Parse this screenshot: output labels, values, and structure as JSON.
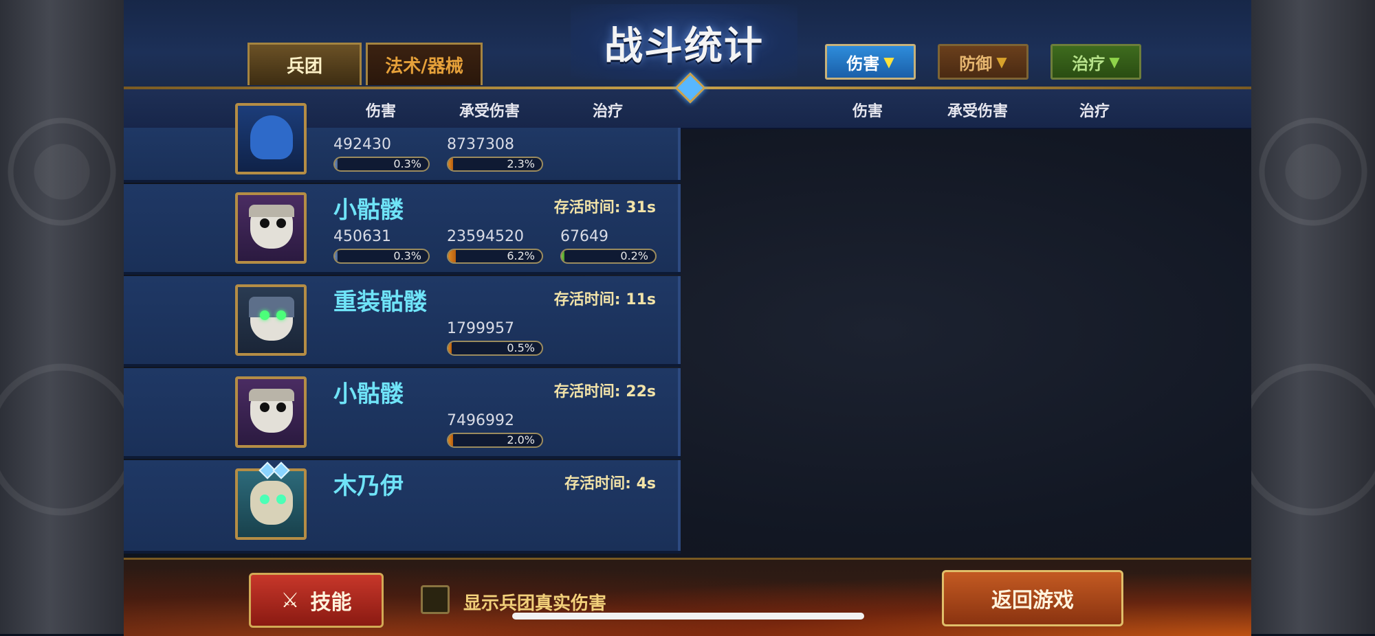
{
  "title": "战斗统计",
  "tabs": {
    "units": "兵团",
    "spells": "法术/器械"
  },
  "filters": {
    "damage": "伤害",
    "defense": "防御",
    "healing": "治疗"
  },
  "columns_left": [
    "伤害",
    "承受伤害",
    "治疗"
  ],
  "columns_right": [
    "伤害",
    "承受伤害",
    "治疗"
  ],
  "survive_prefix": "存活时间:",
  "rows": [
    {
      "name": "",
      "survive": "",
      "dmg": "492430",
      "dmg_pct": "0.3%",
      "taken": "8737308",
      "taken_pct": "2.3%",
      "heal": "",
      "heal_pct": "",
      "avatar_icon": "blue-dragon-icon"
    },
    {
      "name": "小骷髅",
      "survive": "31s",
      "dmg": "450631",
      "dmg_pct": "0.3%",
      "taken": "23594520",
      "taken_pct": "6.2%",
      "heal": "67649",
      "heal_pct": "0.2%",
      "avatar_icon": "skeleton-icon"
    },
    {
      "name": "重装骷髅",
      "survive": "11s",
      "dmg": "",
      "dmg_pct": "",
      "taken": "1799957",
      "taken_pct": "0.5%",
      "heal": "",
      "heal_pct": "",
      "avatar_icon": "armored-skeleton-icon"
    },
    {
      "name": "小骷髅",
      "survive": "22s",
      "dmg": "",
      "dmg_pct": "",
      "taken": "7496992",
      "taken_pct": "2.0%",
      "heal": "",
      "heal_pct": "",
      "avatar_icon": "skeleton-icon"
    },
    {
      "name": "木乃伊",
      "survive": "4s",
      "dmg": "",
      "dmg_pct": "",
      "taken": "",
      "taken_pct": "",
      "heal": "",
      "heal_pct": "",
      "avatar_icon": "mummy-icon"
    }
  ],
  "bottom": {
    "skill_label": "技能",
    "checkbox_label": "显示兵团真实伤害",
    "return_label": "返回游戏"
  },
  "colors": {
    "name": "#6fe3f7",
    "accent_gold": "#c9a24a",
    "damage_blue": "#2e8cdb"
  }
}
